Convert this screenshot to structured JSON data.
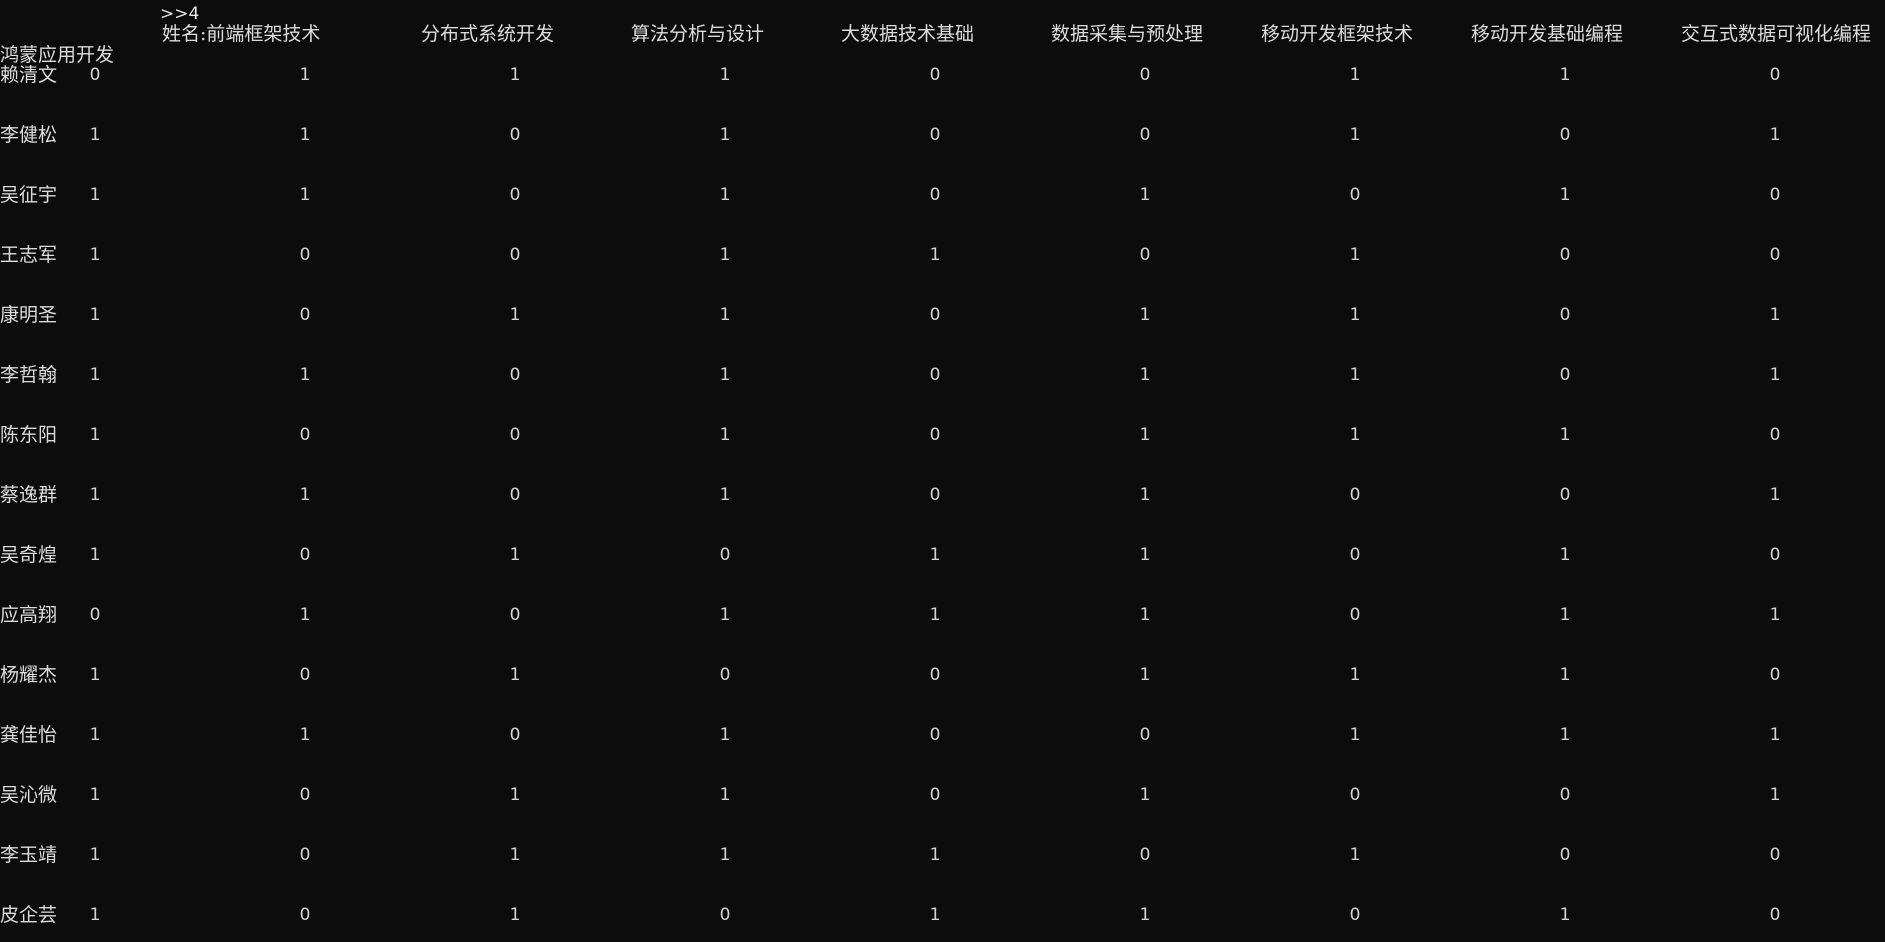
{
  "terminal": {
    "prompt": ">>4",
    "header_first": "姓名:前端框架技术",
    "headers": [
      "分布式系统开发",
      "算法分析与设计",
      "大数据技术基础",
      "数据采集与预处理",
      "移动开发框架技术",
      "移动开发基础编程",
      "交互式数据可视化编程"
    ],
    "header_wrapped": "鸿蒙应用开发",
    "rows": [
      {
        "name": "赖清文",
        "values": [
          "0",
          "1",
          "1",
          "1",
          "0",
          "0",
          "1",
          "1",
          "0"
        ]
      },
      {
        "name": "李健松",
        "values": [
          "1",
          "1",
          "0",
          "1",
          "0",
          "0",
          "1",
          "0",
          "1"
        ]
      },
      {
        "name": "吴征宇",
        "values": [
          "1",
          "1",
          "0",
          "1",
          "0",
          "1",
          "0",
          "1",
          "0"
        ]
      },
      {
        "name": "王志军",
        "values": [
          "1",
          "0",
          "0",
          "1",
          "1",
          "0",
          "1",
          "0",
          "0"
        ]
      },
      {
        "name": "康明圣",
        "values": [
          "1",
          "0",
          "1",
          "1",
          "0",
          "1",
          "1",
          "0",
          "1"
        ]
      },
      {
        "name": "李哲翰",
        "values": [
          "1",
          "1",
          "0",
          "1",
          "0",
          "1",
          "1",
          "0",
          "1"
        ]
      },
      {
        "name": "陈东阳",
        "values": [
          "1",
          "0",
          "0",
          "1",
          "0",
          "1",
          "1",
          "1",
          "0"
        ]
      },
      {
        "name": "蔡逸群",
        "values": [
          "1",
          "1",
          "0",
          "1",
          "0",
          "1",
          "0",
          "0",
          "1"
        ]
      },
      {
        "name": "吴奇煌",
        "values": [
          "1",
          "0",
          "1",
          "0",
          "1",
          "1",
          "0",
          "1",
          "0"
        ]
      },
      {
        "name": "应高翔",
        "values": [
          "0",
          "1",
          "0",
          "1",
          "1",
          "1",
          "0",
          "1",
          "1"
        ]
      },
      {
        "name": "杨耀杰",
        "values": [
          "1",
          "0",
          "1",
          "0",
          "0",
          "1",
          "1",
          "1",
          "0"
        ]
      },
      {
        "name": "龚佳怡",
        "values": [
          "1",
          "1",
          "0",
          "1",
          "0",
          "0",
          "1",
          "1",
          "1"
        ]
      },
      {
        "name": "吴沁微",
        "values": [
          "1",
          "0",
          "1",
          "1",
          "0",
          "1",
          "0",
          "0",
          "1"
        ]
      },
      {
        "name": "李玉靖",
        "values": [
          "1",
          "0",
          "1",
          "1",
          "1",
          "0",
          "1",
          "0",
          "0"
        ]
      },
      {
        "name": "皮企芸",
        "values": [
          "1",
          "0",
          "1",
          "0",
          "1",
          "1",
          "0",
          "1",
          "0"
        ]
      }
    ]
  },
  "colors": {
    "background": "#0c0c0c",
    "foreground": "#d4d4d4"
  }
}
